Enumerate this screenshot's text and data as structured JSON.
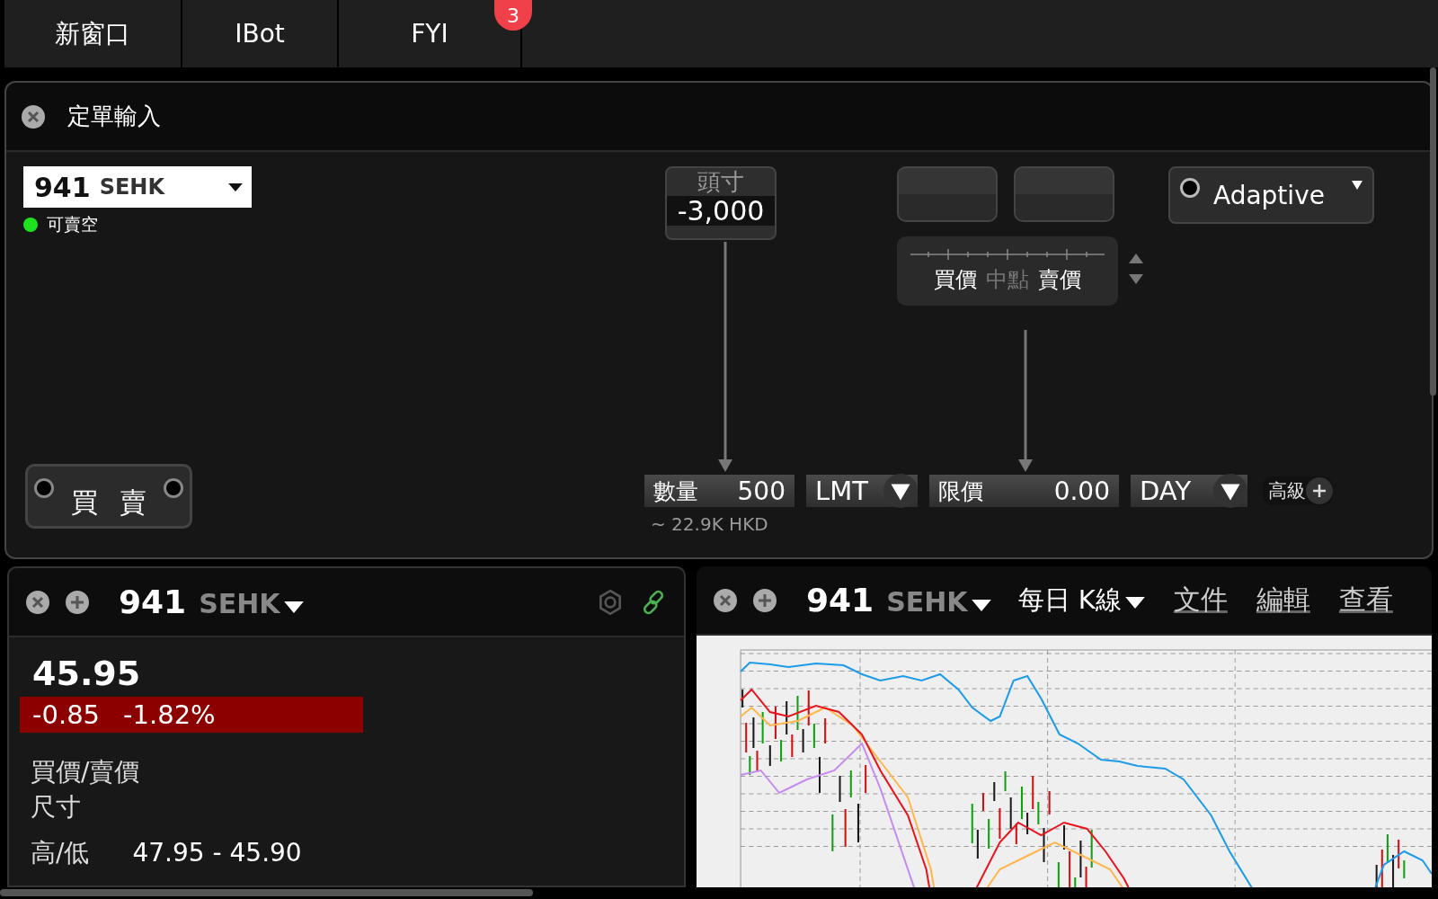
{
  "tabs": [
    {
      "label": "新窗口"
    },
    {
      "label": "IBot"
    },
    {
      "label": "FYI",
      "badge": "3"
    }
  ],
  "order_entry": {
    "title": "定單輸入",
    "symbol": "941",
    "exchange": "SEHK",
    "shortable": {
      "label": "可賣空",
      "available": true
    },
    "position": {
      "label": "頭寸",
      "value": "-3,000"
    },
    "price_scale": [
      {
        "text": "買價",
        "selected": true
      },
      {
        "text": "中點",
        "selected": false
      },
      {
        "text": "賣價",
        "selected": true
      }
    ],
    "algo": "Adaptive",
    "side_button": [
      "買",
      "賣"
    ],
    "quantity": {
      "label": "數量",
      "value": "500"
    },
    "order_type": "LMT",
    "limit_price": {
      "label": "限價",
      "value": "0.00"
    },
    "tif": "DAY",
    "advanced": "高級",
    "notional": "~ 22.9K HKD"
  },
  "quote_panel": {
    "symbol": "941",
    "exchange": "SEHK",
    "last": "45.95",
    "change": "-0.85",
    "change_pct": "-1.82%",
    "rows": [
      {
        "label": "買價/賣價"
      },
      {
        "label": "尺寸"
      },
      {
        "label": "高/低",
        "value": "47.95 - 45.90"
      }
    ]
  },
  "chart_panel": {
    "symbol": "941",
    "exchange": "SEHK",
    "period": "每日 K線",
    "menu": [
      "文件",
      "編輯",
      "查看"
    ]
  }
}
